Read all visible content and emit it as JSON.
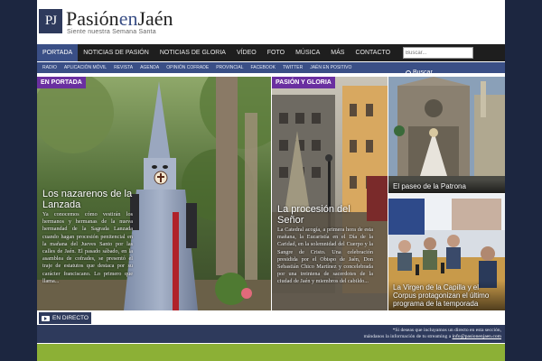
{
  "site": {
    "logo_initials": "PJ",
    "title_part1": "Pasión",
    "title_part2": "en",
    "title_part3": "Jaén",
    "tagline": "Siente nuestra Semana Santa"
  },
  "main_nav": [
    {
      "label": "Portada",
      "active": true
    },
    {
      "label": "Noticias de Pasión",
      "active": false
    },
    {
      "label": "Noticias de Gloria",
      "active": false
    },
    {
      "label": "Vídeo",
      "active": false
    },
    {
      "label": "Foto",
      "active": false
    },
    {
      "label": "Música",
      "active": false
    },
    {
      "label": "Más",
      "active": false
    },
    {
      "label": "Contacto",
      "active": false
    }
  ],
  "search": {
    "placeholder": "Buscar...",
    "button_label": "Buscar"
  },
  "sub_nav": [
    "Radio",
    "Aplicación Móvil",
    "Revista",
    "Agenda",
    "Opinión Cofrade",
    "Provincial",
    "Facebook",
    "Twitter",
    "Jaén en Positivo"
  ],
  "tiles": {
    "main": {
      "tag": "En Portada",
      "title": "Los nazarenos de la Lanzada",
      "excerpt": "Ya conocemos cómo vestirán los hermanos y hermanas de la nueva hermandad de la Sagrada Lanzada cuando hagan procesión penitencial en la mañana del Jueves Santo por las calles de Jaén. El pasado sábado, en la asamblea de cofrades, se presentó el traje de estatutos que destaca por su carácter franciscano. Lo primero que llama..."
    },
    "second": {
      "tag": "Pasión y Gloria",
      "title": "La procesión del Señor",
      "excerpt": "La Catedral acogía, a primera hora de esta mañana, la Eucaristía en el Día de la Caridad, en la solemnidad del Cuerpo y la Sangre de Cristo. Una celebración presidida por el Obispo de Jaén, Don Sebastián Chico Martínez y concelebrada por una treintena de sacerdotes de la ciudad de Jaén y miembros del cabildo..."
    },
    "third": {
      "caption": "El paseo de la Patrona"
    },
    "fourth": {
      "caption": "La Virgen de la Capilla y el Corpus protagonizan el último programa de la temporada"
    }
  },
  "live": {
    "label": "En directo"
  },
  "notice": {
    "line1": "*Si deseas que incluyamos un directo en esta sección,",
    "line2_prefix": "mándanos la información de tu streaming a ",
    "email": "info@pasionenjaen.com"
  },
  "colors": {
    "navy": "#2e3a5c",
    "accent_blue": "#3a4f86",
    "tag_purple": "#6a2fa0",
    "green": "#8cb036",
    "nav_dark": "#1e1e1e"
  },
  "icons": [
    "search-icon",
    "play-icon"
  ]
}
